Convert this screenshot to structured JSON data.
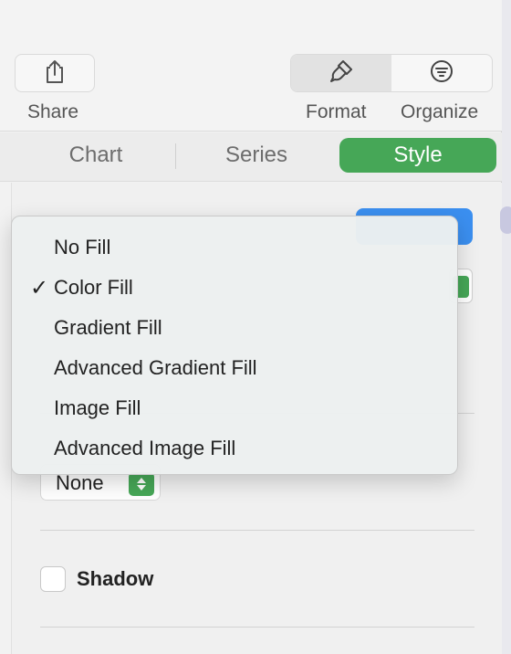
{
  "toolbar": {
    "share_label": "Share",
    "format_label": "Format",
    "organize_label": "Organize"
  },
  "tabs": {
    "chart": "Chart",
    "series": "Series",
    "style": "Style"
  },
  "fill_menu": {
    "items": [
      {
        "label": "No Fill",
        "checked": false
      },
      {
        "label": "Color Fill",
        "checked": true
      },
      {
        "label": "Gradient Fill",
        "checked": false
      },
      {
        "label": "Advanced Gradient Fill",
        "checked": false
      },
      {
        "label": "Image Fill",
        "checked": false
      },
      {
        "label": "Advanced Image Fill",
        "checked": false
      }
    ],
    "check_glyph": "✓"
  },
  "border_popup": {
    "value": "None"
  },
  "shadow": {
    "label": "Shadow",
    "checked": false
  },
  "colors": {
    "accent_green": "#46a757",
    "accent_blue": "#3b8ff0"
  }
}
